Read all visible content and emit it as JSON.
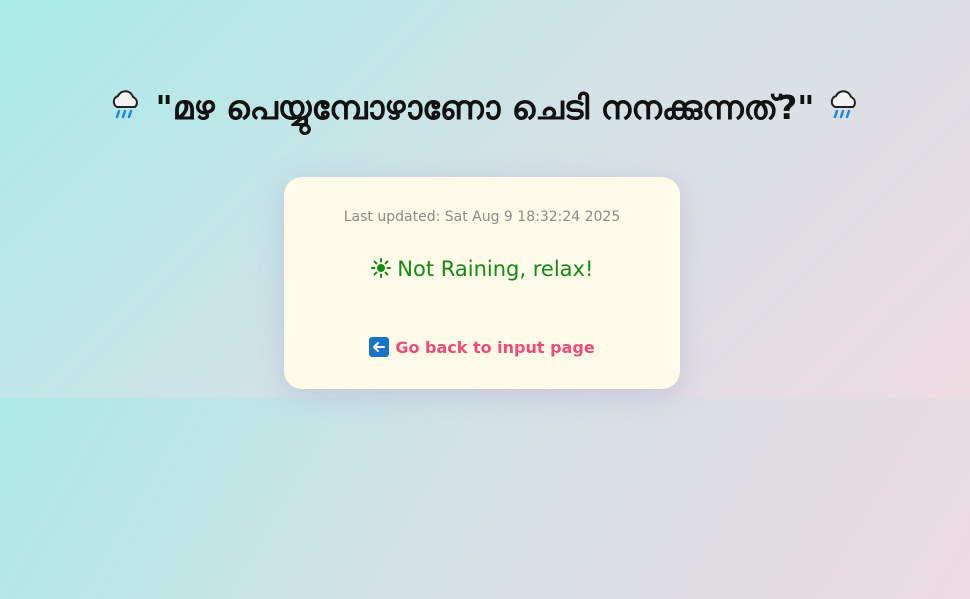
{
  "page": {
    "title": "\"മഴ പെയ്യുമ്പോഴാണോ ചെടി നനക്കുന്നത്?\"",
    "title_icon": "cloud-with-rain-icon"
  },
  "card": {
    "last_updated": "Last updated: Sat Aug 9 18:32:24 2025",
    "status_icon": "sun-icon",
    "status_text": "Not Raining, relax!",
    "back_icon": "left-arrow-icon",
    "back_link_label": "Go back to input page"
  },
  "colors": {
    "status_text": "#138a13",
    "link": "#ee4a7c",
    "card_background": "#fffbe8"
  }
}
